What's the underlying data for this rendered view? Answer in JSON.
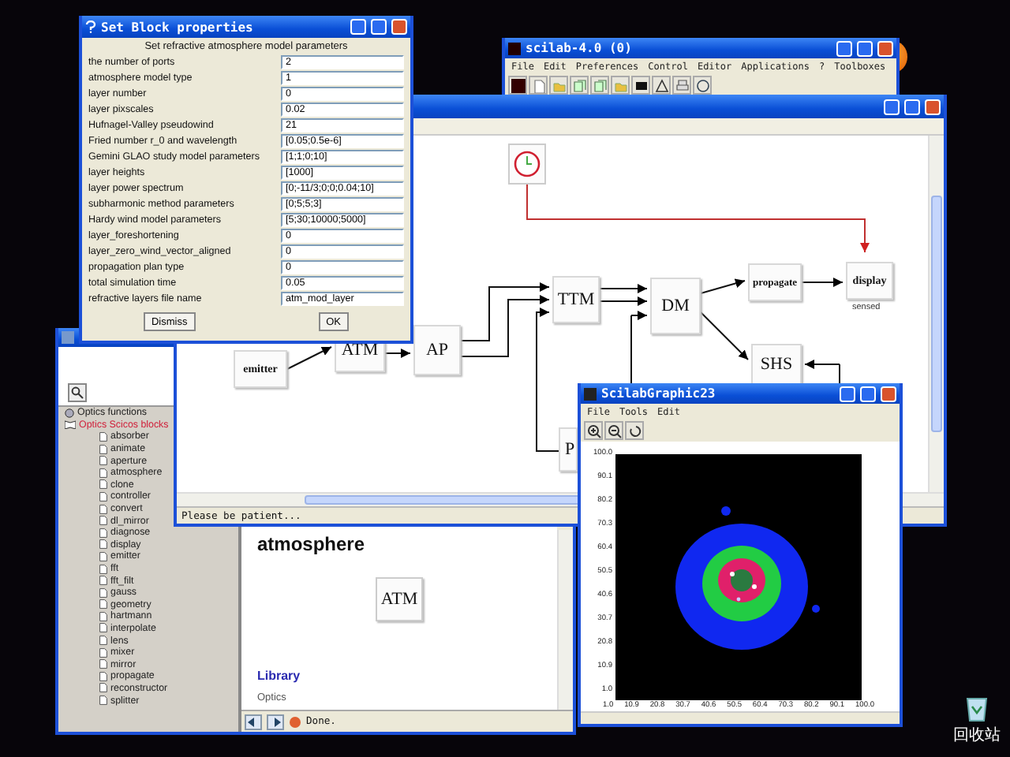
{
  "console_window": {
    "title": "scilab-4.0 (0)",
    "menu": [
      "File",
      "Edit",
      "Preferences",
      "Control",
      "Editor",
      "Applications",
      "?",
      "Toolboxes"
    ]
  },
  "diagram_window": {
    "blocks": [
      {
        "label": "emitter"
      },
      {
        "label": "ATM"
      },
      {
        "label": "AP"
      },
      {
        "label": "TTM"
      },
      {
        "label": "DM"
      },
      {
        "label": "propagate"
      },
      {
        "label": "display",
        "caption": "sensed"
      },
      {
        "label": "SHS"
      },
      {
        "label": "P"
      }
    ],
    "status": "Please be patient..."
  },
  "help_window": {
    "tree": [
      {
        "label": "Optics functions",
        "selected": false
      },
      {
        "label": "Optics Scicos blocks",
        "selected": true,
        "expanded": true,
        "children": [
          {
            "label": "absorber",
            "selected": false
          },
          {
            "label": "animate",
            "selected": false
          },
          {
            "label": "aperture",
            "selected": false
          },
          {
            "label": "atmosphere",
            "selected": false
          },
          {
            "label": "clone",
            "selected": false
          },
          {
            "label": "controller",
            "selected": false
          },
          {
            "label": "convert",
            "selected": false
          },
          {
            "label": "dl_mirror",
            "selected": false
          },
          {
            "label": "diagnose",
            "selected": false
          },
          {
            "label": "display",
            "selected": false
          },
          {
            "label": "emitter",
            "selected": false
          },
          {
            "label": "fft",
            "selected": false
          },
          {
            "label": "fft_filt",
            "selected": false
          },
          {
            "label": "gauss",
            "selected": false
          },
          {
            "label": "geometry",
            "selected": false
          },
          {
            "label": "hartmann",
            "selected": false
          },
          {
            "label": "interpolate",
            "selected": false
          },
          {
            "label": "lens",
            "selected": false
          },
          {
            "label": "mixer",
            "selected": false
          },
          {
            "label": "mirror",
            "selected": false
          },
          {
            "label": "propagate",
            "selected": false
          },
          {
            "label": "reconstructor",
            "selected": false
          },
          {
            "label": "splitter",
            "selected": false
          }
        ]
      }
    ],
    "page_heading": "atmosphere",
    "block_label": "ATM",
    "link": "Library",
    "breadcrumb": "Optics",
    "status": "Done."
  },
  "graphic_window": {
    "title": "ScilabGraphic23",
    "menu": [
      "File",
      "Tools",
      "Edit"
    ],
    "y_ticks": [
      "100.0",
      "90.1",
      "80.2",
      "70.3",
      "60.4",
      "50.5",
      "40.6",
      "30.7",
      "20.8",
      "10.9",
      "1.0"
    ],
    "x_ticks": [
      "1.0",
      "10.9",
      "20.8",
      "30.7",
      "40.6",
      "50.5",
      "60.4",
      "70.3",
      "80.2",
      "90.1",
      "100.0"
    ]
  },
  "dialog": {
    "title": "Set Block properties",
    "heading": "Set refractive atmosphere model parameters",
    "fields": [
      {
        "label": "the number of ports",
        "value": "2"
      },
      {
        "label": "atmosphere model type",
        "value": "1"
      },
      {
        "label": "layer number",
        "value": "0"
      },
      {
        "label": "layer pixscales",
        "value": "0.02"
      },
      {
        "label": "Hufnagel-Valley pseudowind",
        "value": "21"
      },
      {
        "label": "Fried number r_0 and wavelength",
        "value": "[0.05;0.5e-6]"
      },
      {
        "label": "Gemini GLAO study model parameters",
        "value": "[1;1;0;10]"
      },
      {
        "label": "layer heights",
        "value": "[1000]"
      },
      {
        "label": "layer power spectrum",
        "value": "[0;-11/3;0;0;0.04;10]"
      },
      {
        "label": "subharmonic method parameters",
        "value": "[0;5;5;3]"
      },
      {
        "label": "Hardy wind model parameters",
        "value": "[5;30;10000;5000]"
      },
      {
        "label": "layer_foreshortening",
        "value": "0"
      },
      {
        "label": "layer_zero_wind_vector_aligned",
        "value": "0"
      },
      {
        "label": "propagation plan type",
        "value": "0"
      },
      {
        "label": "total simulation time",
        "value": "0.05"
      },
      {
        "label": "refractive layers file name",
        "value": "atm_mod_layer"
      }
    ],
    "buttons": [
      "Dismiss",
      "OK"
    ]
  },
  "desktop_icons": [
    {
      "label": "回收站"
    }
  ]
}
